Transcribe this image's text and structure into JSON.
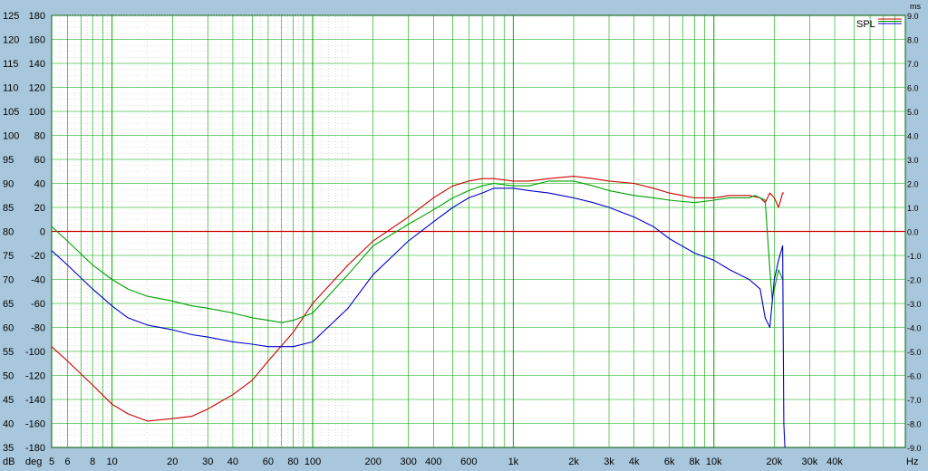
{
  "chart_data": {
    "type": "line",
    "x_scale": "log",
    "x_unit": "Hz",
    "xlim": [
      5,
      90000
    ],
    "db_ticks": [
      125,
      120,
      115,
      110,
      105,
      100,
      95,
      90,
      85,
      80,
      75,
      70,
      65,
      60,
      55,
      50,
      45,
      40,
      35
    ],
    "db_unit": "dB",
    "deg_ticks": [
      180,
      160,
      140,
      120,
      100,
      80,
      60,
      40,
      20,
      0,
      -20,
      -40,
      -60,
      -80,
      -100,
      -120,
      -140,
      -160,
      -180
    ],
    "deg_unit": "deg",
    "ms_ticks": [
      "9.0",
      "8.0",
      "7.0",
      "6.0",
      "5.0",
      "4.0",
      "3.0",
      "2.0",
      "1.0",
      "0.0",
      "-1.0",
      "-2.0",
      "-3.0",
      "-4.0",
      "-5.0",
      "-6.0",
      "-7.0",
      "-8.0",
      "-9.0"
    ],
    "ms_unit": "ms",
    "x_ticks": [
      {
        "v": 5,
        "label": "5"
      },
      {
        "v": 6,
        "label": "6"
      },
      {
        "v": 8,
        "label": "8"
      },
      {
        "v": 10,
        "label": "10"
      },
      {
        "v": 20,
        "label": "20"
      },
      {
        "v": 30,
        "label": "30"
      },
      {
        "v": 40,
        "label": "40"
      },
      {
        "v": 60,
        "label": "60"
      },
      {
        "v": 80,
        "label": "80"
      },
      {
        "v": 100,
        "label": "100"
      },
      {
        "v": 200,
        "label": "200"
      },
      {
        "v": 300,
        "label": "300"
      },
      {
        "v": 400,
        "label": "400"
      },
      {
        "v": 600,
        "label": "600"
      },
      {
        "v": 1000,
        "label": "1k"
      },
      {
        "v": 2000,
        "label": "2k"
      },
      {
        "v": 3000,
        "label": "3k"
      },
      {
        "v": 4000,
        "label": "4k"
      },
      {
        "v": 6000,
        "label": "6k"
      },
      {
        "v": 8000,
        "label": "8k"
      },
      {
        "v": 10000,
        "label": "10k"
      },
      {
        "v": 20000,
        "label": "20k"
      },
      {
        "v": 30000,
        "label": "30k"
      },
      {
        "v": 40000,
        "label": "40k"
      }
    ],
    "grid": true,
    "reference_line_db": 80,
    "legend": {
      "label": "SPL",
      "position": "top-right"
    },
    "series": [
      {
        "color": "#cc0000",
        "x": [
          5,
          6,
          8,
          10,
          12,
          15,
          20,
          25,
          30,
          40,
          50,
          60,
          80,
          100,
          150,
          200,
          300,
          400,
          500,
          600,
          700,
          800,
          1000,
          1200,
          1500,
          2000,
          2500,
          3000,
          4000,
          5000,
          6000,
          8000,
          10000,
          12000,
          15000,
          17000,
          18000,
          19000,
          20000,
          21000,
          22000,
          22300
        ],
        "y": [
          56,
          53,
          48,
          44,
          42,
          40.5,
          41,
          41.5,
          43,
          46,
          49,
          53,
          59,
          65,
          73,
          78,
          83,
          87,
          89.5,
          90.5,
          91,
          91,
          90.5,
          90.5,
          91,
          91.5,
          91,
          90.5,
          90,
          89,
          88,
          87,
          87,
          87.5,
          87.5,
          87,
          86,
          88,
          87,
          85,
          88,
          88
        ]
      },
      {
        "color": "#00a000",
        "x": [
          5,
          6,
          8,
          10,
          12,
          15,
          20,
          25,
          30,
          40,
          50,
          60,
          70,
          80,
          100,
          150,
          200,
          300,
          400,
          500,
          600,
          700,
          800,
          1000,
          1200,
          1500,
          2000,
          2500,
          3000,
          4000,
          5000,
          6000,
          8000,
          10000,
          12000,
          15000,
          16000,
          17000,
          18000,
          19000,
          19500,
          20000,
          21000,
          22000
        ],
        "y": [
          81,
          78,
          73,
          70,
          68,
          66.5,
          65.5,
          64.5,
          64,
          63,
          62,
          61.5,
          61,
          61.5,
          63,
          71,
          77,
          81.5,
          84.5,
          87,
          88.5,
          89.5,
          90,
          89.5,
          89.5,
          90.5,
          90.5,
          89.5,
          88.5,
          87.5,
          87,
          86.5,
          86,
          86.5,
          87,
          87,
          87.5,
          87,
          86.5,
          72,
          66,
          68,
          72,
          70
        ]
      },
      {
        "color": "#0000cc",
        "x": [
          5,
          6,
          8,
          10,
          12,
          15,
          20,
          25,
          30,
          40,
          50,
          60,
          70,
          80,
          100,
          150,
          200,
          300,
          400,
          500,
          600,
          700,
          800,
          1000,
          1200,
          1500,
          2000,
          2500,
          3000,
          4000,
          5000,
          6000,
          8000,
          10000,
          12000,
          15000,
          17000,
          18000,
          19000,
          20000,
          21000,
          22000,
          22300,
          22600
        ],
        "y": [
          76,
          73,
          68,
          64.5,
          62,
          60.5,
          59.5,
          58.5,
          58,
          57,
          56.5,
          56,
          56,
          56,
          57,
          64,
          71,
          78,
          82,
          85,
          87,
          88,
          89,
          89,
          88.5,
          88,
          87,
          86,
          85,
          83,
          81,
          78.5,
          75.5,
          74,
          72,
          70,
          68,
          62,
          60,
          70,
          74,
          77,
          40,
          35
        ]
      }
    ]
  }
}
